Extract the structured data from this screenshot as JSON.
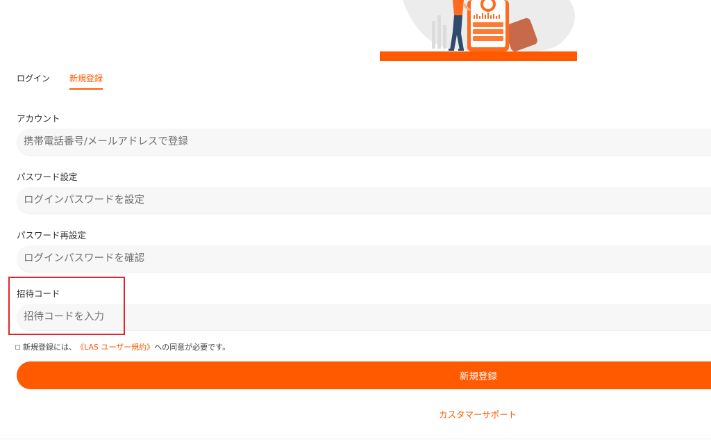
{
  "tabs": {
    "login": "ログイン",
    "register": "新規登録"
  },
  "form": {
    "account": {
      "label": "アカウント",
      "placeholder": "携帯電話番号/メールアドレスで登録"
    },
    "password": {
      "label": "パスワード設定",
      "placeholder": "ログインパスワードを設定"
    },
    "password_confirm": {
      "label": "パスワード再設定",
      "placeholder": "ログインパスワードを確認"
    },
    "invite_code": {
      "label": "招待コード",
      "placeholder": "招待コードを入力"
    }
  },
  "agreement": {
    "prefix": "新規登録には、",
    "link": "《LAS ユーザー規約》",
    "suffix": "への同意が必要です。"
  },
  "submit_label": "新規登録",
  "support_label": "カスタマーサポート",
  "colors": {
    "accent": "#ff5a00",
    "highlight": "#e0242c"
  }
}
